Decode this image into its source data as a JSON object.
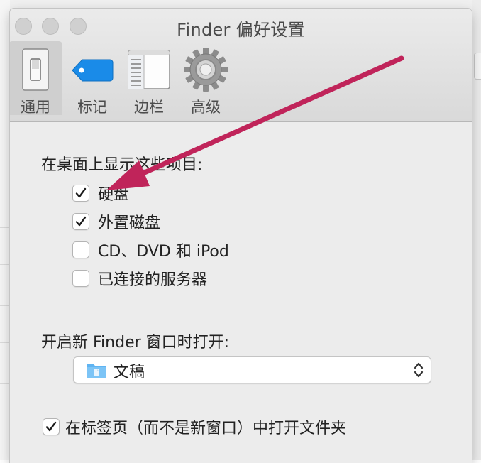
{
  "window": {
    "title": "Finder 偏好设置"
  },
  "toolbar": {
    "items": [
      {
        "label": "通用",
        "icon": "general-switch-icon"
      },
      {
        "label": "标记",
        "icon": "tag-icon"
      },
      {
        "label": "边栏",
        "icon": "sidebar-icon"
      },
      {
        "label": "高级",
        "icon": "gear-icon"
      }
    ]
  },
  "desktop_section": {
    "heading": "在桌面上显示这些项目:",
    "items": [
      {
        "label": "硬盘",
        "checked": true
      },
      {
        "label": "外置磁盘",
        "checked": true
      },
      {
        "label": "CD、DVD 和 iPod",
        "checked": false
      },
      {
        "label": "已连接的服务器",
        "checked": false
      }
    ]
  },
  "new_window": {
    "heading": "开启新 Finder 窗口时打开:",
    "selected": "文稿"
  },
  "tabs_option": {
    "label": "在标签页（而不是新窗口）中打开文件夹",
    "checked": true
  },
  "colors": {
    "accent_tag": "#1a8be8",
    "annotation_arrow": "#c0245a",
    "folder": "#5fb4f2"
  }
}
